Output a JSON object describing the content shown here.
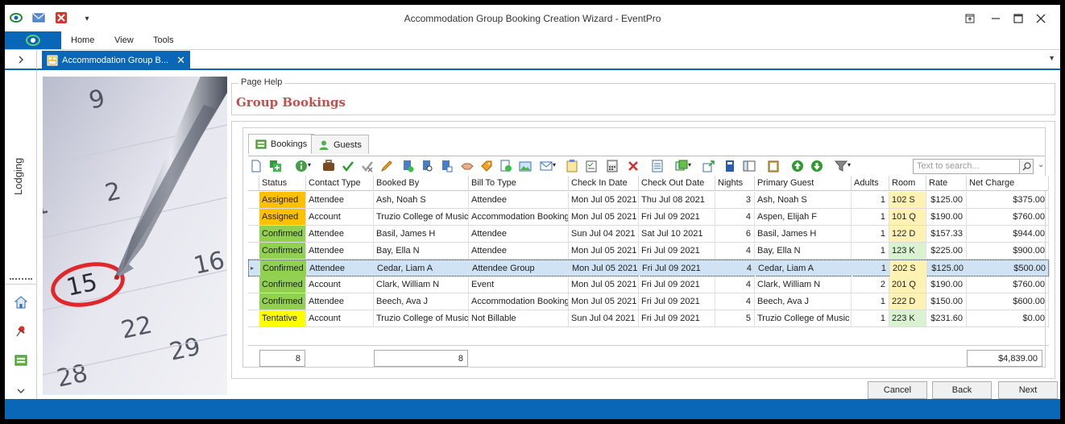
{
  "window": {
    "title": "Accommodation Group Booking Creation Wizard - EventPro"
  },
  "menu": {
    "items": [
      "Home",
      "View",
      "Tools"
    ]
  },
  "doc_tab": {
    "label": "Accommodation Group B...",
    "close_glyph": "✕"
  },
  "nav": {
    "expand_glyph": "›",
    "lodging": "Lodging",
    "collapse_glyph": "⌄"
  },
  "page_help": {
    "label": "Page Help",
    "title": "Group Bookings"
  },
  "subtabs": [
    {
      "label": "Bookings",
      "icon": "bookings-icon"
    },
    {
      "label": "Guests",
      "icon": "guests-icon"
    }
  ],
  "search": {
    "placeholder": "Text to search..."
  },
  "grid": {
    "columns": [
      "Status",
      "Contact Type",
      "Booked By",
      "Bill To Type",
      "Check In Date",
      "Check Out Date",
      "Nights",
      "Primary Guest",
      "Adults",
      "Room",
      "Rate",
      "Net Charge"
    ],
    "rows": [
      {
        "status": "Assigned",
        "contact_type": "Attendee",
        "booked_by": "Ash, Noah S",
        "bill_to": "Attendee",
        "check_in": "Mon Jul 05 2021",
        "check_out": "Thu Jul 08 2021",
        "nights": "3",
        "guest": "Ash, Noah S",
        "adults": "1",
        "room": "102 S",
        "rate": "$125.00",
        "net": "$375.00"
      },
      {
        "status": "Assigned",
        "contact_type": "Account",
        "booked_by": "Truzio College of Music",
        "bill_to": "Accommodation Booking",
        "check_in": "Mon Jul 05 2021",
        "check_out": "Fri Jul 09 2021",
        "nights": "4",
        "guest": "Aspen, Elijah F",
        "adults": "1",
        "room": "101 Q",
        "rate": "$190.00",
        "net": "$760.00"
      },
      {
        "status": "Confirmed",
        "contact_type": "Attendee",
        "booked_by": "Basil, James H",
        "bill_to": "Attendee",
        "check_in": "Sun Jul 04 2021",
        "check_out": "Sat Jul 10 2021",
        "nights": "6",
        "guest": "Basil, James H",
        "adults": "1",
        "room": "122 D",
        "rate": "$157.33",
        "net": "$944.00"
      },
      {
        "status": "Confirmed",
        "contact_type": "Attendee",
        "booked_by": "Bay, Ella N",
        "bill_to": "Attendee",
        "check_in": "Mon Jul 05 2021",
        "check_out": "Fri Jul 09 2021",
        "nights": "4",
        "guest": "Bay, Ella N",
        "adults": "1",
        "room": "123 K",
        "rate": "$225.00",
        "net": "$900.00"
      },
      {
        "status": "Confirmed",
        "contact_type": "Attendee",
        "booked_by": "Cedar, Liam A",
        "bill_to": "Attendee Group",
        "check_in": "Mon Jul 05 2021",
        "check_out": "Fri Jul 09 2021",
        "nights": "4",
        "guest": "Cedar, Liam A",
        "adults": "1",
        "room": "202 S",
        "rate": "$125.00",
        "net": "$500.00"
      },
      {
        "status": "Confirmed",
        "contact_type": "Account",
        "booked_by": "Clark, William N",
        "bill_to": "Event",
        "check_in": "Mon Jul 05 2021",
        "check_out": "Fri Jul 09 2021",
        "nights": "4",
        "guest": "Clark, William N",
        "adults": "2",
        "room": "201 Q",
        "rate": "$190.00",
        "net": "$760.00"
      },
      {
        "status": "Confirmed",
        "contact_type": "Attendee",
        "booked_by": "Beech, Ava J",
        "bill_to": "Accommodation Booking",
        "check_in": "Mon Jul 05 2021",
        "check_out": "Fri Jul 09 2021",
        "nights": "4",
        "guest": "Beech, Ava J",
        "adults": "1",
        "room": "222 D",
        "rate": "$150.00",
        "net": "$600.00"
      },
      {
        "status": "Tentative",
        "contact_type": "Account",
        "booked_by": "Truzio College of Music",
        "bill_to": "Not Billable",
        "check_in": "Sun Jul 04 2021",
        "check_out": "Fri Jul 09 2021",
        "nights": "5",
        "guest": "Truzio College of Music",
        "adults": "1",
        "room": "223 K",
        "rate": "$231.60",
        "net": "$0.00"
      }
    ],
    "selected_row": 4,
    "summary": {
      "status_count": "8",
      "booked_by_count": "8",
      "net_total": "$4,839.00"
    }
  },
  "status_colors": {
    "Assigned": "#ffc000",
    "Confirmed": "#92d050",
    "Tentative": "#ffff00"
  },
  "room_colors": {
    "S": "#fff2b3",
    "Q": "#fff2b3",
    "D": "#fff2b3",
    "K": "#d9f2d0"
  },
  "buttons": {
    "cancel": "Cancel",
    "back": "Back",
    "next": "Next"
  },
  "accent": "#0a66b7",
  "title_color": "#c0504d"
}
